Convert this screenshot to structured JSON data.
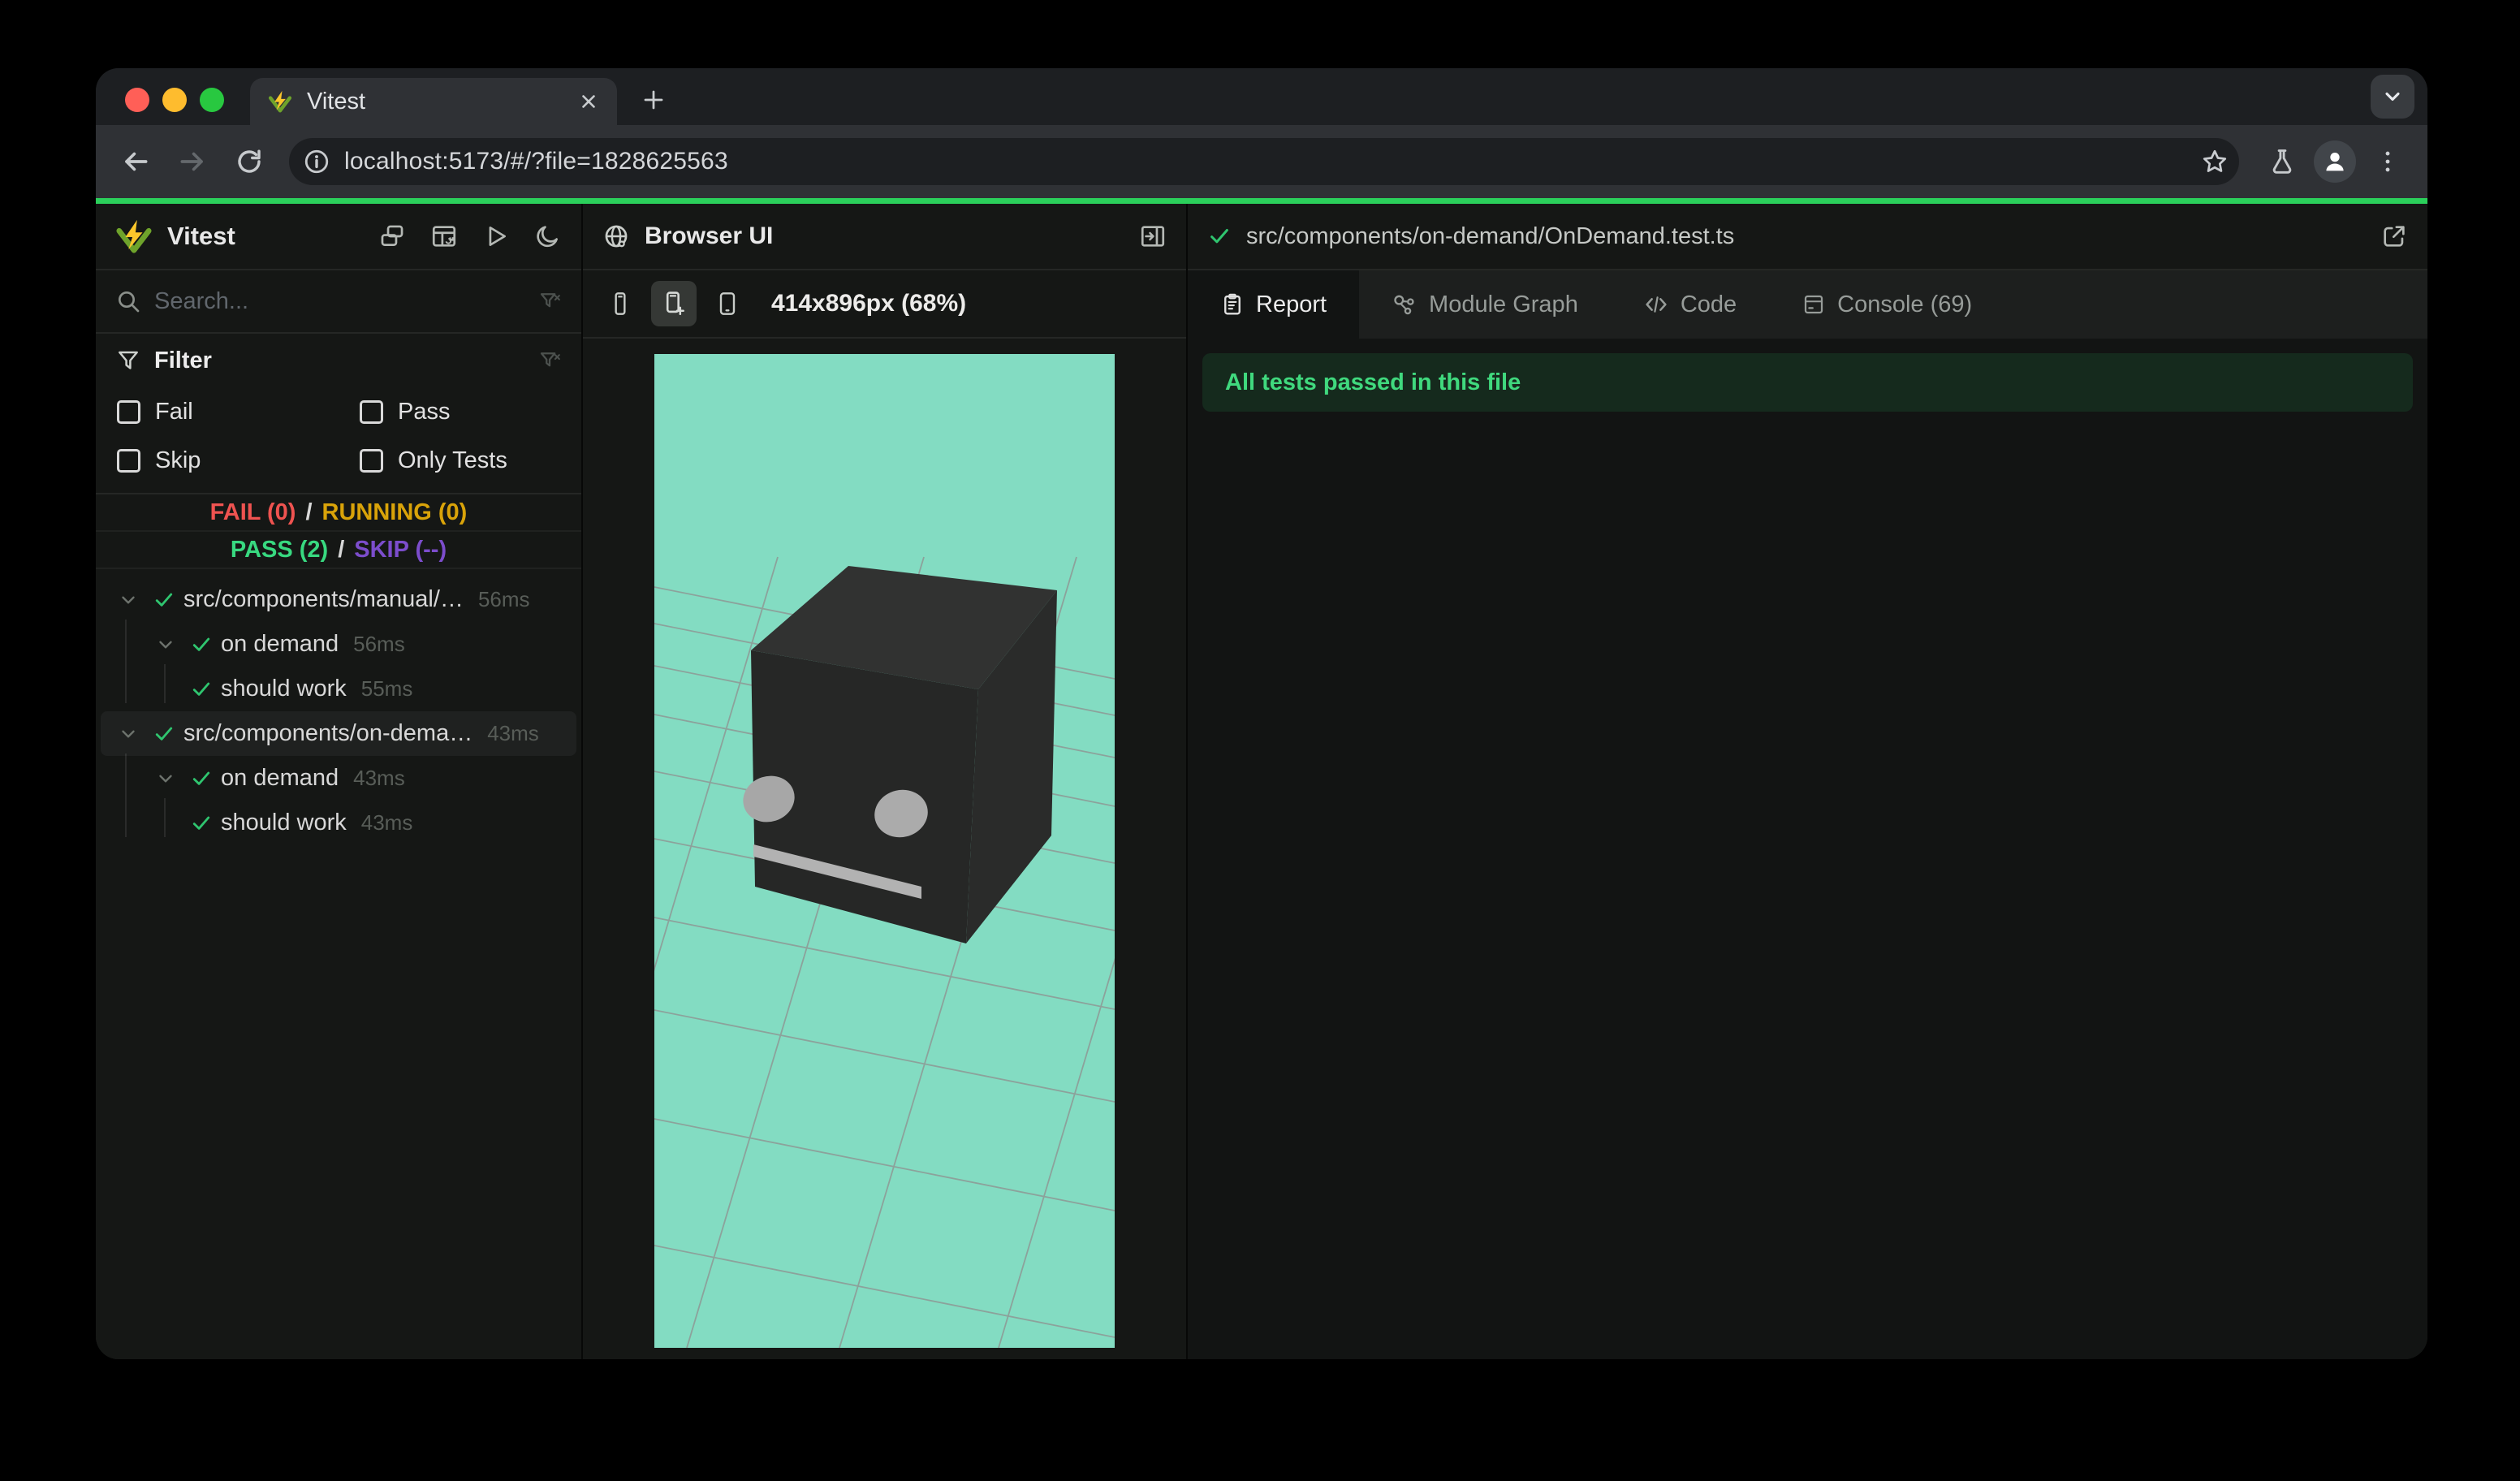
{
  "window": {
    "tab_title": "Vitest",
    "url": "localhost:5173/#/?file=1828625563"
  },
  "sidebar": {
    "app_name": "Vitest",
    "search": {
      "placeholder": "Search..."
    },
    "filter": {
      "title": "Filter",
      "options": [
        {
          "label": "Fail",
          "checked": false
        },
        {
          "label": "Pass",
          "checked": false
        },
        {
          "label": "Skip",
          "checked": false
        },
        {
          "label": "Only Tests",
          "checked": false
        }
      ]
    },
    "summary": {
      "fail": "FAIL (0)",
      "running": "RUNNING (0)",
      "pass": "PASS (2)",
      "skip": "SKIP (--)",
      "sep": "/"
    },
    "tree": [
      {
        "label": "src/components/manual/…",
        "duration": "56ms",
        "level": 0,
        "status": "pass",
        "expanded": true,
        "selected": false
      },
      {
        "label": "on demand",
        "duration": "56ms",
        "level": 1,
        "status": "pass",
        "expanded": true,
        "selected": false
      },
      {
        "label": "should work",
        "duration": "55ms",
        "level": 2,
        "status": "pass",
        "expanded": false,
        "selected": false
      },
      {
        "label": "src/components/on-dema…",
        "duration": "43ms",
        "level": 0,
        "status": "pass",
        "expanded": true,
        "selected": true
      },
      {
        "label": "on demand",
        "duration": "43ms",
        "level": 1,
        "status": "pass",
        "expanded": true,
        "selected": false
      },
      {
        "label": "should work",
        "duration": "43ms",
        "level": 2,
        "status": "pass",
        "expanded": false,
        "selected": false
      }
    ]
  },
  "preview": {
    "title": "Browser UI",
    "viewport": "414x896px (68%)",
    "canvas_bg": "#83dcc2"
  },
  "details": {
    "file_path": "src/components/on-demand/OnDemand.test.ts",
    "tabs": [
      {
        "label": "Report",
        "active": true
      },
      {
        "label": "Module Graph",
        "active": false
      },
      {
        "label": "Code",
        "active": false
      },
      {
        "label": "Console (69)",
        "active": false
      }
    ],
    "banner": "All tests passed in this file"
  },
  "colors": {
    "accent_green": "#2bd05b",
    "pass": "#38d980",
    "fail": "#ef5350",
    "running": "#d9a309",
    "skip": "#7c4dcc",
    "canvas": "#83dcc2",
    "banner_bg": "#152a1d",
    "banner_text": "#40d97e",
    "traffic_red": "#ff5f57",
    "traffic_yellow": "#febc2e",
    "traffic_green": "#28c840"
  }
}
